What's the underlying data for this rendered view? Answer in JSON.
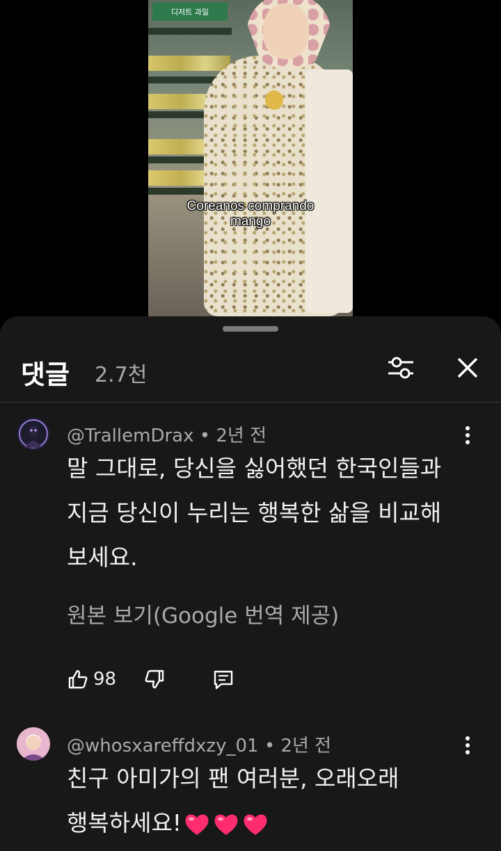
{
  "video": {
    "store_sign": "디저트 과일",
    "caption_line1": "Coreanos comprando",
    "caption_line2": "mango"
  },
  "comments_panel": {
    "title": "댓글",
    "count": "2.7천",
    "icons": {
      "filter": "filter-icon",
      "close": "close-icon"
    }
  },
  "comments": [
    {
      "author": "@TrallemDrax",
      "time": "2년 전",
      "lines": [
        "말 그대로, 당신을 싫어했던 한국인들과",
        "지금 당신이 누리는 행복한 삶을 비교해",
        "보세요."
      ],
      "translate_link": "원본 보기(Google 번역 제공)",
      "likes": "98"
    },
    {
      "author": "@whosxareffdxzy_01",
      "time": "2년 전",
      "lines": [
        "친구 아미가의 팬 여러분, 오래오래",
        "행복하세요!"
      ],
      "emoji_count": 3,
      "emoji_color": "#ff2d6f"
    }
  ],
  "colors": {
    "sheet_bg": "#181818",
    "secondary_text": "#aaaaaa",
    "primary_text": "#f1f1f1"
  }
}
